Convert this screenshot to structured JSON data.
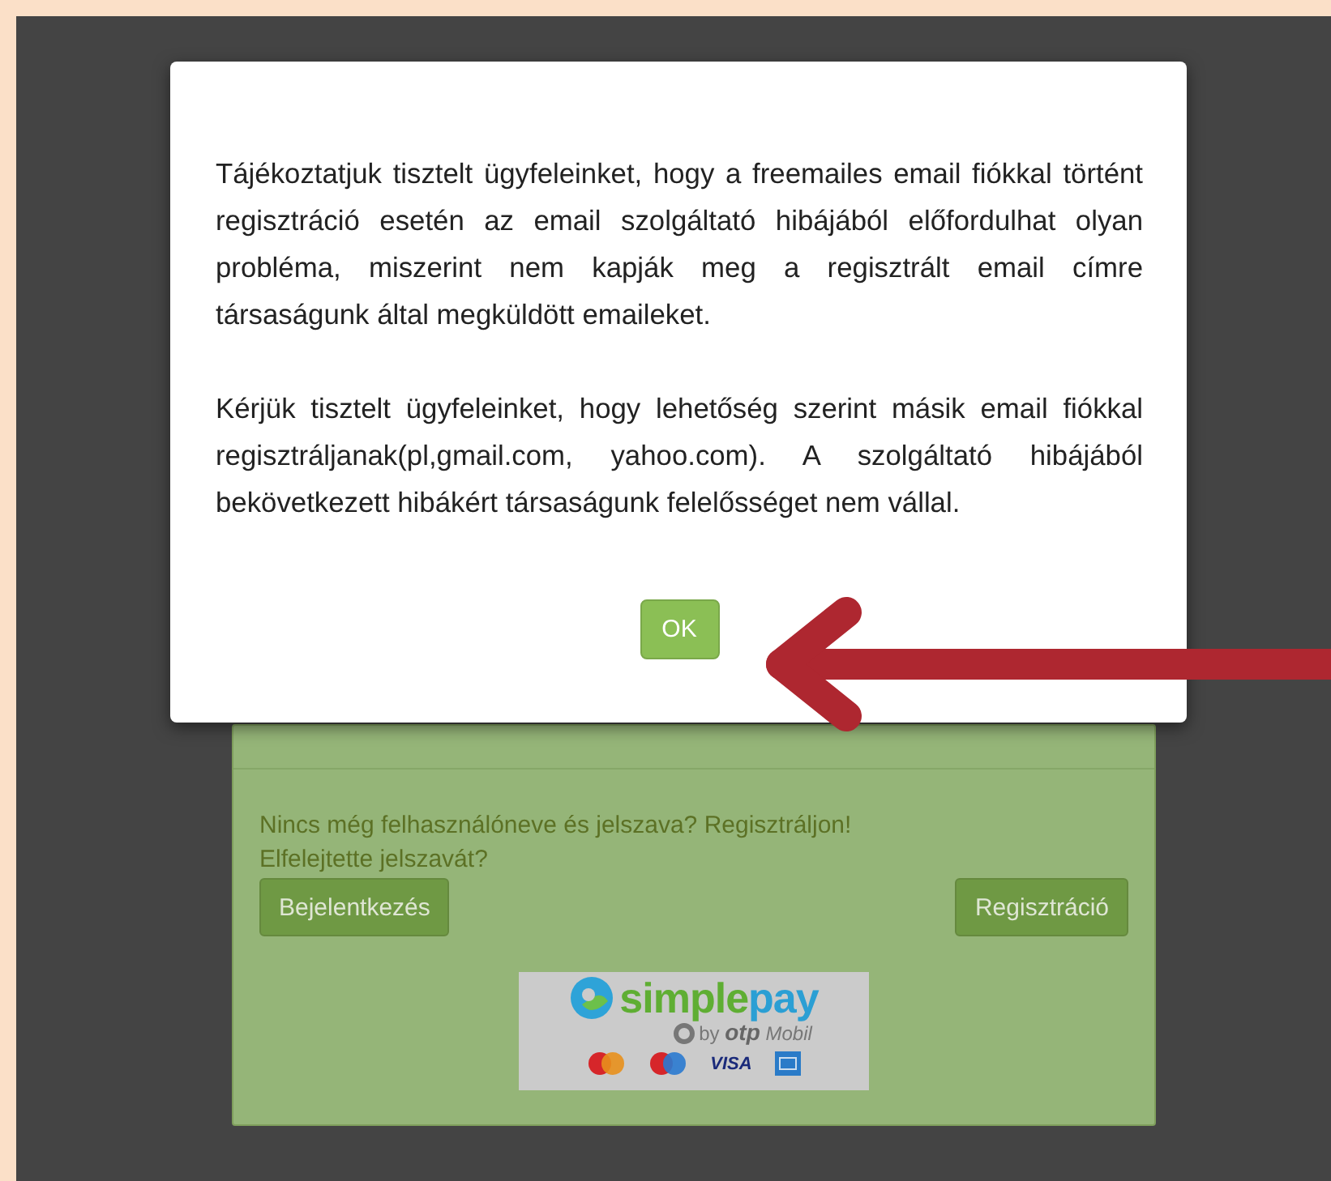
{
  "dialog": {
    "paragraphs": [
      "Tájékoztatjuk tisztelt ügyfeleinket, hogy a freemailes email fiókkal történt regisztráció esetén az email szolgáltató hibájából előfordulhat olyan probléma, miszerint nem kapják meg a regisztrált email címre társaságunk által megküldött emaileket.",
      "Kérjük tisztelt ügyfeleinket, hogy lehetőség szerint másik email fiókkal regisztráljanak(pl,gmail.com, yahoo.com). A szolgáltató hibájából bekövetkezett hibákért társaságunk felelősséget nem vállal."
    ],
    "ok_button": "OK"
  },
  "login_card": {
    "register_prompt": "Nincs még felhasználóneve és jelszava? Regisztráljon!",
    "forgot_password": "Elfelejtette jelszavát?",
    "login_button": "Bejelentkezés",
    "register_button": "Regisztráció",
    "payment_logo": {
      "wordmark_start": "simple",
      "wordmark_end": "pay",
      "byline": "by **otp** *Mobil*",
      "card_brand": "VISA"
    }
  }
}
